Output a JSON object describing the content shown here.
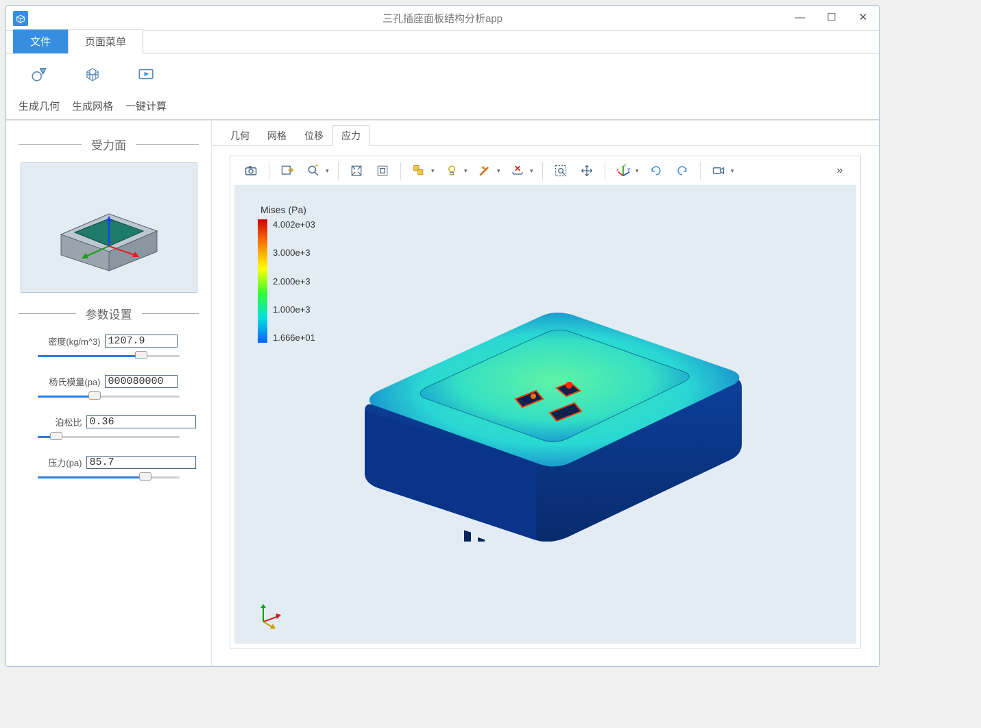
{
  "app": {
    "title": "三孔插座面板结构分析app"
  },
  "menu_tabs": {
    "file": "文件",
    "page_menu": "页面菜单"
  },
  "ribbon": [
    {
      "icon": "geometry-icon",
      "label": "生成几何"
    },
    {
      "icon": "mesh-icon",
      "label": "生成网格"
    },
    {
      "icon": "compute-icon",
      "label": "一键计算"
    }
  ],
  "sidebar": {
    "section1_title": "受力面",
    "section2_title": "参数设置",
    "params": [
      {
        "label": "密度(kg/m^3)",
        "value": "1207.9",
        "slider": 73
      },
      {
        "label": "杨氏模量(pa)",
        "value": "000080000",
        "slider": 40
      },
      {
        "label": "泊松比",
        "value": "0.36",
        "slider": 13
      },
      {
        "label": "压力(pa)",
        "value": "85.7",
        "slider": 76
      }
    ]
  },
  "view_tabs": [
    "几何",
    "网格",
    "位移",
    "应力"
  ],
  "view_tabs_active_index": 3,
  "toolbar_icons": [
    "camera-icon",
    "export-image-icon",
    "zoom-icon",
    "zoom-extents-icon",
    "zoom-box-icon",
    "select-icon",
    "light-icon",
    "transparency-icon",
    "ruler-icon",
    "zoom-select-icon",
    "pan-icon",
    "axis-icon",
    "rotate-cw-icon",
    "rotate-ccw-icon",
    "video-icon",
    "more-icon"
  ],
  "chart_data": {
    "type": "heatmap",
    "title": "Mises (Pa)",
    "colorbar": {
      "ticks": [
        "4.002e+03",
        "3.000e+3",
        "2.000e+3",
        "1.000e+3",
        "1.666e+01"
      ],
      "min": 16.66,
      "max": 4002,
      "colors_high_to_low": [
        "red",
        "orange",
        "yellow",
        "green",
        "cyan",
        "blue"
      ]
    },
    "description": "Von Mises stress distribution on a three-hole socket panel solid, isometric view. Blue (~17 Pa) on body edges and sides, green/cyan (~1000–2000 Pa) on raised top face, small red hotspots (~4000 Pa) around the three slot openings."
  }
}
